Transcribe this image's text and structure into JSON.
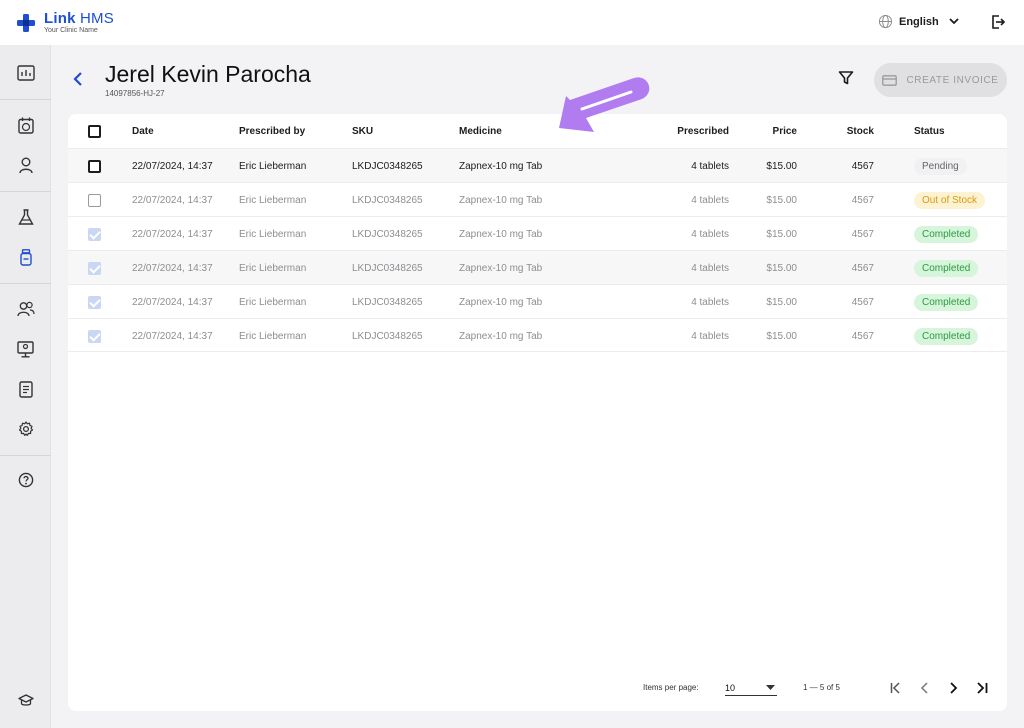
{
  "brand": {
    "name_bold": "Link",
    "name_rest": " HMS",
    "subtitle": "Your Clinic Name",
    "color": "#1f4fd1"
  },
  "header": {
    "language": "English"
  },
  "sidebar": {
    "items": [
      {
        "name": "dashboard-icon"
      },
      {
        "name": "appointments-icon"
      },
      {
        "name": "patients-icon"
      },
      {
        "name": "lab-icon"
      },
      {
        "name": "pharmacy-icon",
        "active": true
      },
      {
        "name": "staff-icon"
      },
      {
        "name": "monitor-icon"
      },
      {
        "name": "reports-icon"
      },
      {
        "name": "settings-icon"
      },
      {
        "name": "help-icon"
      },
      {
        "name": "education-icon"
      }
    ]
  },
  "patient": {
    "name": "Jerel Kevin Parocha",
    "id": "14097856-HJ-27"
  },
  "toolbar": {
    "create_invoice": "CREATE INVOICE"
  },
  "table": {
    "headers": {
      "date": "Date",
      "prescribed_by": "Prescribed by",
      "sku": "SKU",
      "medicine": "Medicine",
      "prescribed": "Prescribed",
      "price": "Price",
      "stock": "Stock",
      "status": "Status"
    },
    "rows": [
      {
        "date": "22/07/2024, 14:37",
        "prescribed_by": "Eric Lieberman",
        "sku": "LKDJC0348265",
        "medicine": "Zapnex-10 mg Tab",
        "prescribed": "4 tablets",
        "price": "$15.00",
        "stock": "4567",
        "status": "Pending",
        "checked": false
      },
      {
        "date": "22/07/2024, 14:37",
        "prescribed_by": "Eric Lieberman",
        "sku": "LKDJC0348265",
        "medicine": "Zapnex-10 mg Tab",
        "prescribed": "4 tablets",
        "price": "$15.00",
        "stock": "4567",
        "status": "Out of Stock",
        "checked": false
      },
      {
        "date": "22/07/2024, 14:37",
        "prescribed_by": "Eric Lieberman",
        "sku": "LKDJC0348265",
        "medicine": "Zapnex-10 mg Tab",
        "prescribed": "4 tablets",
        "price": "$15.00",
        "stock": "4567",
        "status": "Completed",
        "checked": true
      },
      {
        "date": "22/07/2024, 14:37",
        "prescribed_by": "Eric Lieberman",
        "sku": "LKDJC0348265",
        "medicine": "Zapnex-10 mg Tab",
        "prescribed": "4 tablets",
        "price": "$15.00",
        "stock": "4567",
        "status": "Completed",
        "checked": true
      },
      {
        "date": "22/07/2024, 14:37",
        "prescribed_by": "Eric Lieberman",
        "sku": "LKDJC0348265",
        "medicine": "Zapnex-10 mg Tab",
        "prescribed": "4 tablets",
        "price": "$15.00",
        "stock": "4567",
        "status": "Completed",
        "checked": true
      },
      {
        "date": "22/07/2024, 14:37",
        "prescribed_by": "Eric Lieberman",
        "sku": "LKDJC0348265",
        "medicine": "Zapnex-10 mg Tab",
        "prescribed": "4 tablets",
        "price": "$15.00",
        "stock": "4567",
        "status": "Completed",
        "checked": true
      }
    ]
  },
  "pagination": {
    "items_per_page_label": "Items per page:",
    "items_per_page": "10",
    "range": "1 — 5 of 5"
  },
  "colors": {
    "annotation": "#b07cf0",
    "pending_bg": "#f1f1f3",
    "out_of_stock": "#d79a11",
    "completed": "#2f9a44"
  }
}
